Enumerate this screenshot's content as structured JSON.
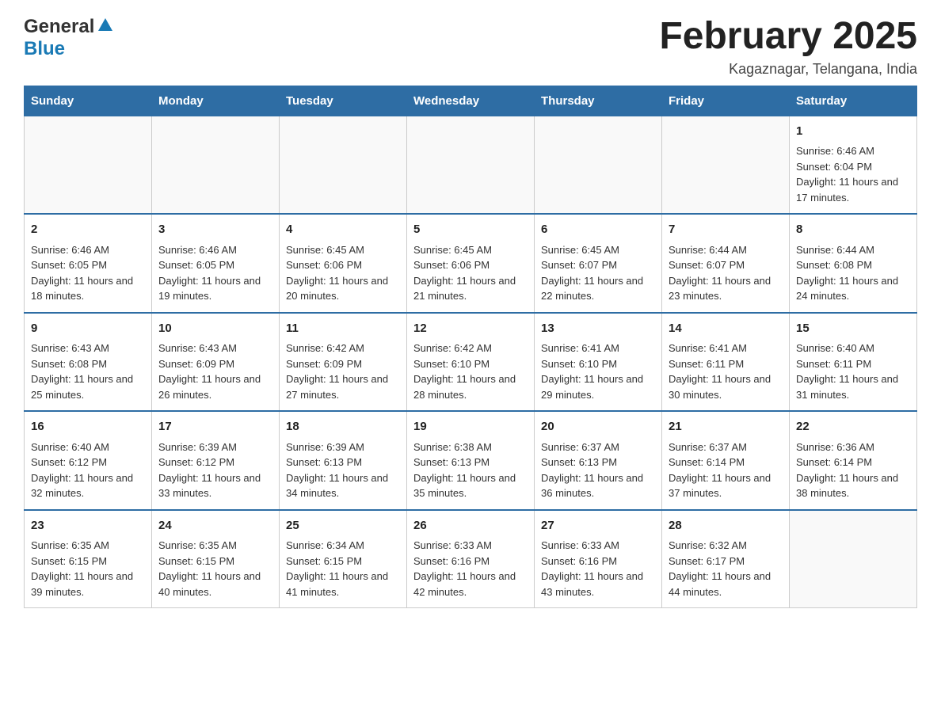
{
  "logo": {
    "general": "General",
    "blue": "Blue"
  },
  "title": "February 2025",
  "subtitle": "Kagaznagar, Telangana, India",
  "days_of_week": [
    "Sunday",
    "Monday",
    "Tuesday",
    "Wednesday",
    "Thursday",
    "Friday",
    "Saturday"
  ],
  "weeks": [
    {
      "days": [
        {
          "number": "",
          "empty": true
        },
        {
          "number": "",
          "empty": true
        },
        {
          "number": "",
          "empty": true
        },
        {
          "number": "",
          "empty": true
        },
        {
          "number": "",
          "empty": true
        },
        {
          "number": "",
          "empty": true
        },
        {
          "number": "1",
          "sunrise": "6:46 AM",
          "sunset": "6:04 PM",
          "daylight": "11 hours and 17 minutes."
        }
      ]
    },
    {
      "days": [
        {
          "number": "2",
          "sunrise": "6:46 AM",
          "sunset": "6:05 PM",
          "daylight": "11 hours and 18 minutes."
        },
        {
          "number": "3",
          "sunrise": "6:46 AM",
          "sunset": "6:05 PM",
          "daylight": "11 hours and 19 minutes."
        },
        {
          "number": "4",
          "sunrise": "6:45 AM",
          "sunset": "6:06 PM",
          "daylight": "11 hours and 20 minutes."
        },
        {
          "number": "5",
          "sunrise": "6:45 AM",
          "sunset": "6:06 PM",
          "daylight": "11 hours and 21 minutes."
        },
        {
          "number": "6",
          "sunrise": "6:45 AM",
          "sunset": "6:07 PM",
          "daylight": "11 hours and 22 minutes."
        },
        {
          "number": "7",
          "sunrise": "6:44 AM",
          "sunset": "6:07 PM",
          "daylight": "11 hours and 23 minutes."
        },
        {
          "number": "8",
          "sunrise": "6:44 AM",
          "sunset": "6:08 PM",
          "daylight": "11 hours and 24 minutes."
        }
      ]
    },
    {
      "days": [
        {
          "number": "9",
          "sunrise": "6:43 AM",
          "sunset": "6:08 PM",
          "daylight": "11 hours and 25 minutes."
        },
        {
          "number": "10",
          "sunrise": "6:43 AM",
          "sunset": "6:09 PM",
          "daylight": "11 hours and 26 minutes."
        },
        {
          "number": "11",
          "sunrise": "6:42 AM",
          "sunset": "6:09 PM",
          "daylight": "11 hours and 27 minutes."
        },
        {
          "number": "12",
          "sunrise": "6:42 AM",
          "sunset": "6:10 PM",
          "daylight": "11 hours and 28 minutes."
        },
        {
          "number": "13",
          "sunrise": "6:41 AM",
          "sunset": "6:10 PM",
          "daylight": "11 hours and 29 minutes."
        },
        {
          "number": "14",
          "sunrise": "6:41 AM",
          "sunset": "6:11 PM",
          "daylight": "11 hours and 30 minutes."
        },
        {
          "number": "15",
          "sunrise": "6:40 AM",
          "sunset": "6:11 PM",
          "daylight": "11 hours and 31 minutes."
        }
      ]
    },
    {
      "days": [
        {
          "number": "16",
          "sunrise": "6:40 AM",
          "sunset": "6:12 PM",
          "daylight": "11 hours and 32 minutes."
        },
        {
          "number": "17",
          "sunrise": "6:39 AM",
          "sunset": "6:12 PM",
          "daylight": "11 hours and 33 minutes."
        },
        {
          "number": "18",
          "sunrise": "6:39 AM",
          "sunset": "6:13 PM",
          "daylight": "11 hours and 34 minutes."
        },
        {
          "number": "19",
          "sunrise": "6:38 AM",
          "sunset": "6:13 PM",
          "daylight": "11 hours and 35 minutes."
        },
        {
          "number": "20",
          "sunrise": "6:37 AM",
          "sunset": "6:13 PM",
          "daylight": "11 hours and 36 minutes."
        },
        {
          "number": "21",
          "sunrise": "6:37 AM",
          "sunset": "6:14 PM",
          "daylight": "11 hours and 37 minutes."
        },
        {
          "number": "22",
          "sunrise": "6:36 AM",
          "sunset": "6:14 PM",
          "daylight": "11 hours and 38 minutes."
        }
      ]
    },
    {
      "days": [
        {
          "number": "23",
          "sunrise": "6:35 AM",
          "sunset": "6:15 PM",
          "daylight": "11 hours and 39 minutes."
        },
        {
          "number": "24",
          "sunrise": "6:35 AM",
          "sunset": "6:15 PM",
          "daylight": "11 hours and 40 minutes."
        },
        {
          "number": "25",
          "sunrise": "6:34 AM",
          "sunset": "6:15 PM",
          "daylight": "11 hours and 41 minutes."
        },
        {
          "number": "26",
          "sunrise": "6:33 AM",
          "sunset": "6:16 PM",
          "daylight": "11 hours and 42 minutes."
        },
        {
          "number": "27",
          "sunrise": "6:33 AM",
          "sunset": "6:16 PM",
          "daylight": "11 hours and 43 minutes."
        },
        {
          "number": "28",
          "sunrise": "6:32 AM",
          "sunset": "6:17 PM",
          "daylight": "11 hours and 44 minutes."
        },
        {
          "number": "",
          "empty": true
        }
      ]
    }
  ]
}
